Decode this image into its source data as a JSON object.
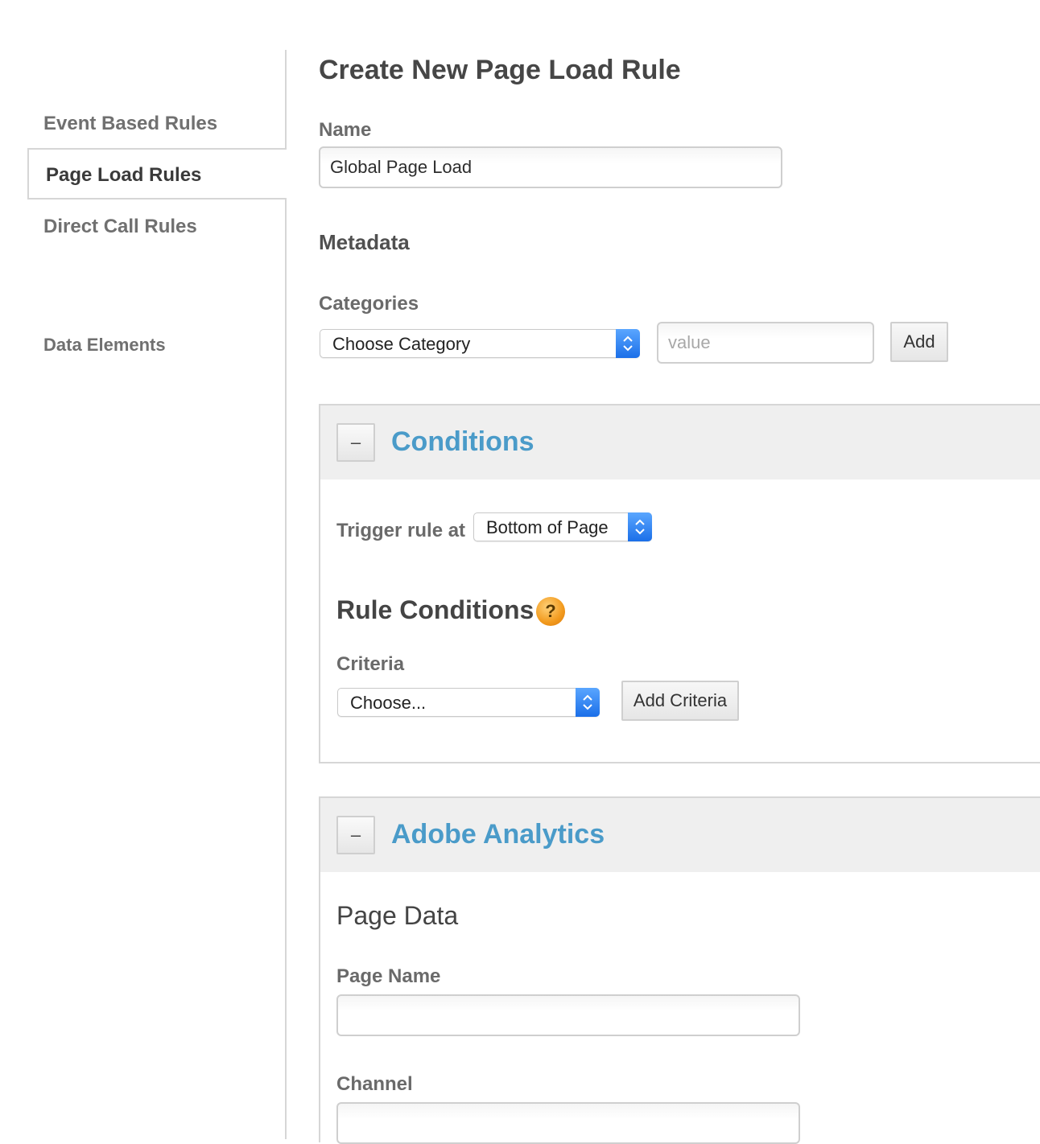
{
  "sidebar": {
    "items": [
      {
        "label": "Event Based Rules"
      },
      {
        "label": "Page Load Rules"
      },
      {
        "label": "Direct Call Rules"
      },
      {
        "label": "Data Elements"
      }
    ]
  },
  "main": {
    "title": "Create New Page Load Rule",
    "name_label": "Name",
    "name_value": "Global Page Load",
    "metadata_heading": "Metadata",
    "categories_label": "Categories",
    "category_select": "Choose Category",
    "category_value_placeholder": "value",
    "add_button": "Add"
  },
  "conditions": {
    "title": "Conditions",
    "collapse_label": "–",
    "trigger_label": "Trigger rule at",
    "trigger_select": "Bottom of Page",
    "rule_conditions_heading": "Rule Conditions",
    "help_glyph": "?",
    "criteria_label": "Criteria",
    "criteria_select": "Choose...",
    "add_criteria_button": "Add Criteria"
  },
  "analytics": {
    "title": "Adobe Analytics",
    "collapse_label": "–",
    "page_data_heading": "Page Data",
    "page_name_label": "Page Name",
    "page_name_value": "",
    "channel_label": "Channel",
    "channel_value": ""
  },
  "colors": {
    "accent": "#4a9bc9",
    "select_arrow": "#1b6fe8",
    "help_icon": "#f29a1d"
  }
}
